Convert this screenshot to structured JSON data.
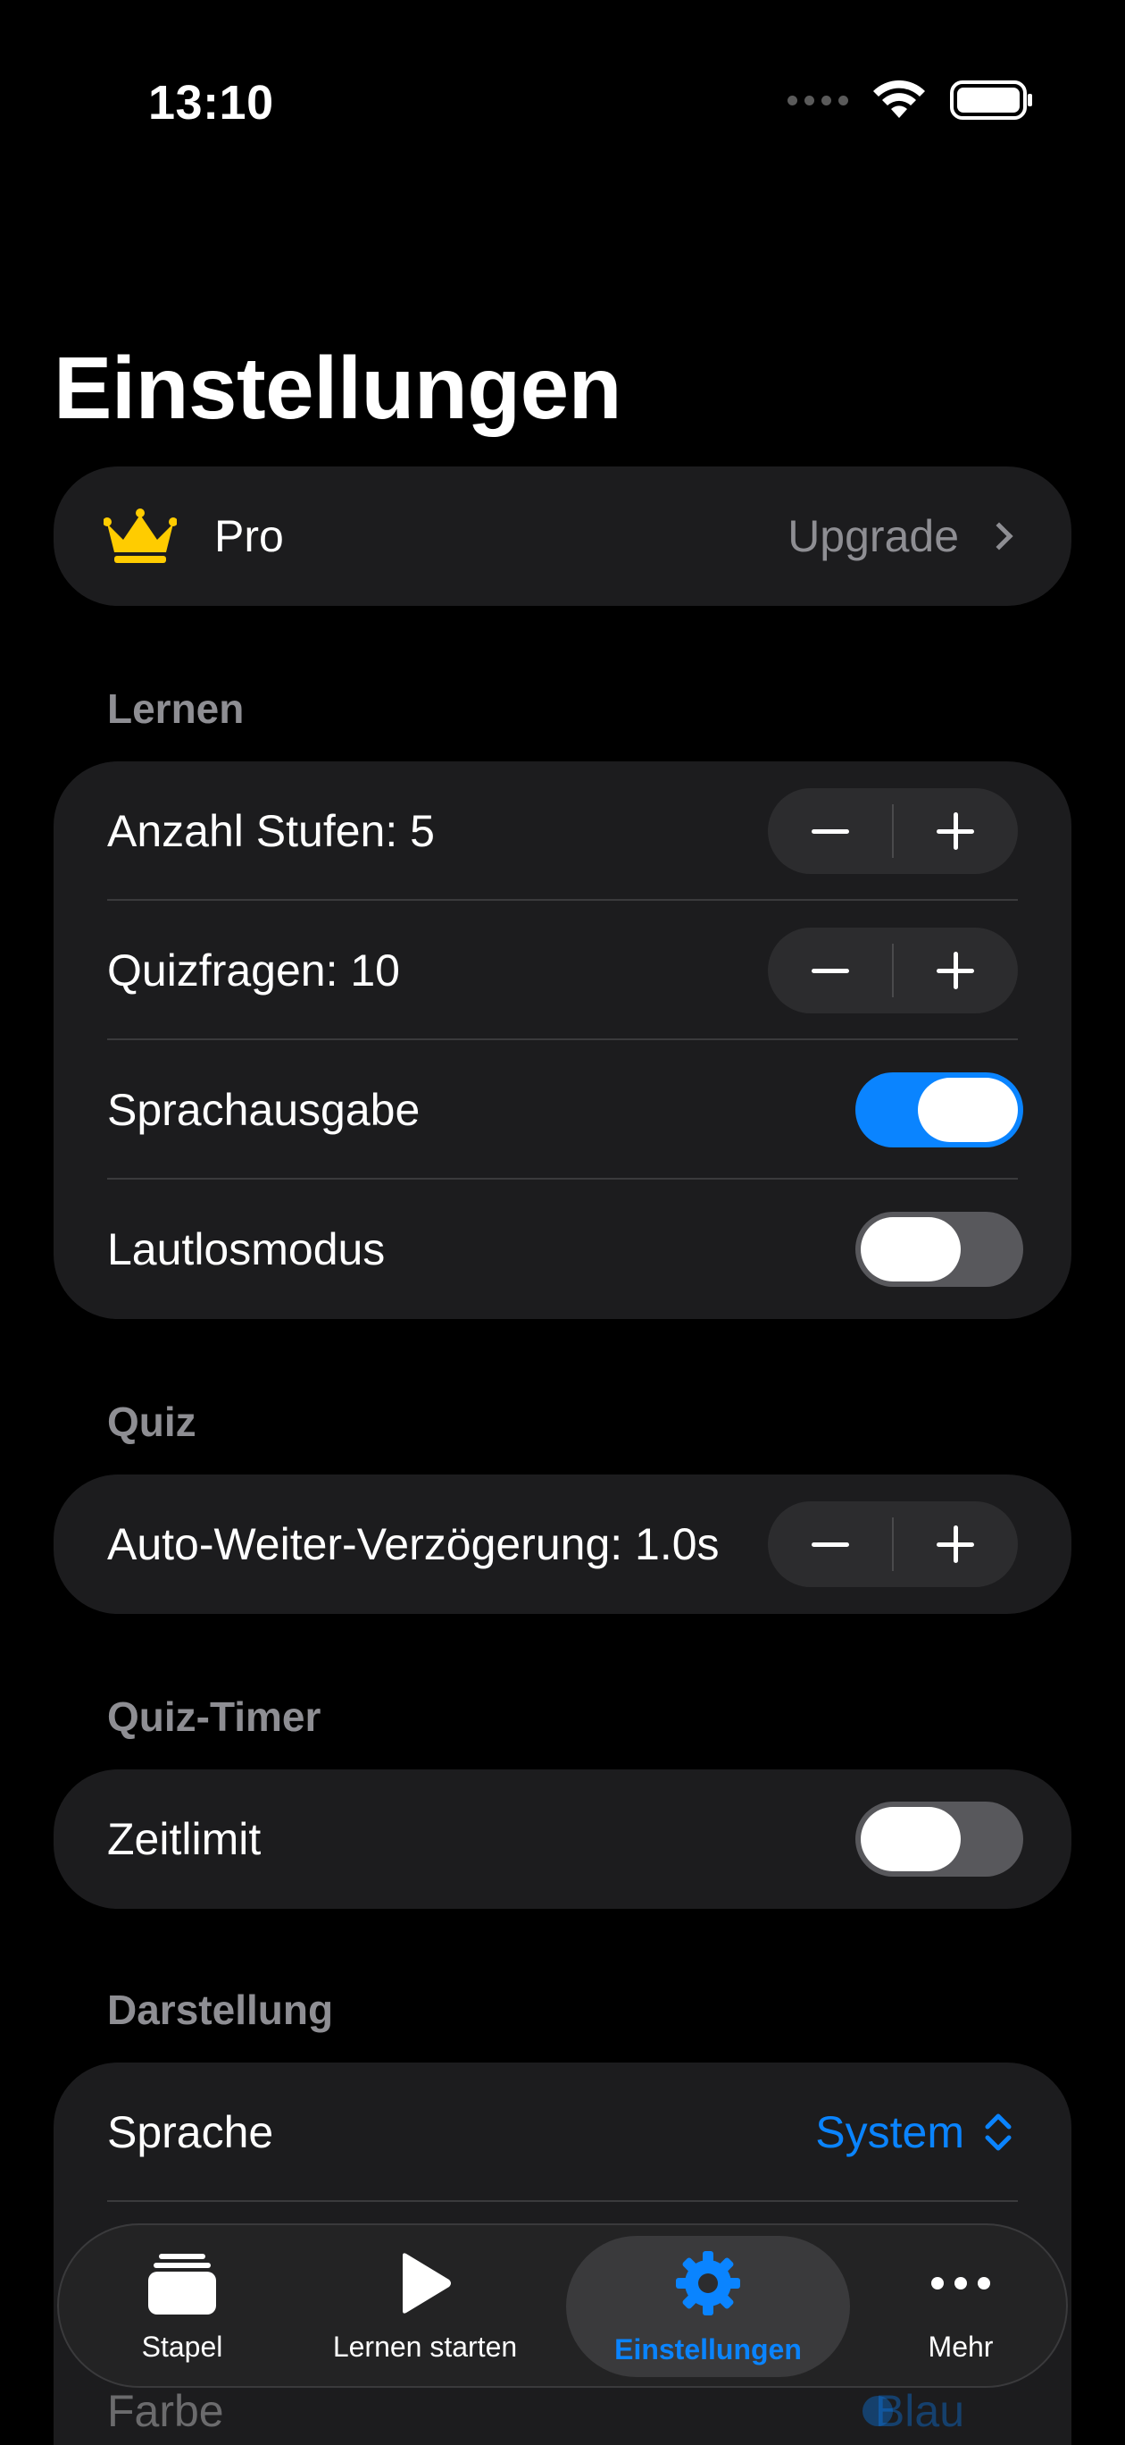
{
  "status": {
    "time": "13:10"
  },
  "title": "Einstellungen",
  "pro": {
    "label": "Pro",
    "action": "Upgrade"
  },
  "sections": {
    "lernen": {
      "header": "Lernen",
      "levels_label": "Anzahl Stufen: 5",
      "quiz_questions_label": "Quizfragen: 10",
      "speech_label": "Sprachausgabe",
      "speech_on": true,
      "silent_label": "Lautlosmodus",
      "silent_on": false
    },
    "quiz": {
      "header": "Quiz",
      "auto_next_label": "Auto-Weiter-Verzögerung: 1.0s"
    },
    "quiz_timer": {
      "header": "Quiz-Timer",
      "time_limit_label": "Zeitlimit",
      "time_limit_on": false
    },
    "darstellung": {
      "header": "Darstellung",
      "language_label": "Sprache",
      "language_value": "System",
      "color_label": "Farbe",
      "color_value": "Blau"
    }
  },
  "tabs": [
    {
      "label": "Stapel",
      "icon": "cards-stack-icon"
    },
    {
      "label": "Lernen starten",
      "icon": "play-icon"
    },
    {
      "label": "Einstellungen",
      "icon": "gear-icon",
      "active": true
    },
    {
      "label": "Mehr",
      "icon": "more-icon"
    }
  ],
  "colors": {
    "accent": "#0a84ff",
    "card": "#1c1c1e",
    "crown": "#ffcc00"
  }
}
